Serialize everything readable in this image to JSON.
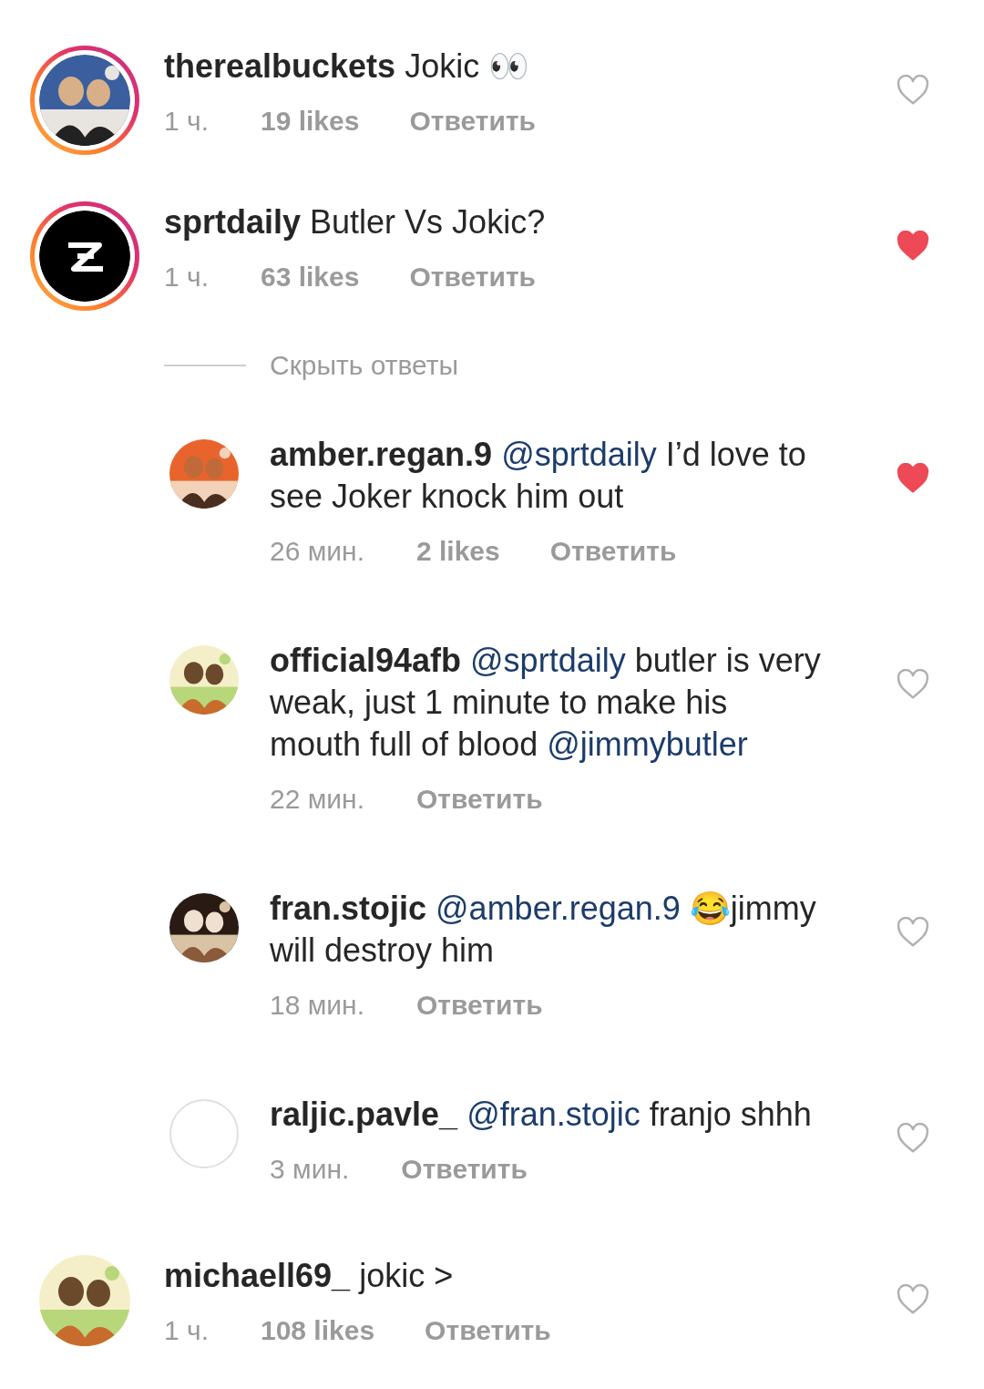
{
  "comments": [
    {
      "user": "therealbuckets",
      "segments": [
        {
          "kind": "plain",
          "text": "Jokic 👀"
        }
      ],
      "time": "1 ч.",
      "likes": "19 likes",
      "reply": "Ответить",
      "liked": false,
      "story_ring": true,
      "avatar": {
        "kind": "picture"
      }
    },
    {
      "user": "sprtdaily",
      "segments": [
        {
          "kind": "plain",
          "text": "Butler Vs Jokic?"
        }
      ],
      "time": "1 ч.",
      "likes": "63 likes",
      "reply": "Ответить",
      "liked": true,
      "story_ring": true,
      "avatar": {
        "kind": "logo"
      },
      "replies_toggle": "Скрыть ответы",
      "children": [
        {
          "user": "amber.regan.9",
          "segments": [
            {
              "kind": "mention",
              "text": "@sprtdaily"
            },
            {
              "kind": "plain",
              "text": " I’d love to see Joker knock him out"
            }
          ],
          "time": "26 мин.",
          "likes": "2 likes",
          "reply": "Ответить",
          "liked": true,
          "story_ring": false,
          "avatar": {
            "kind": "picture"
          }
        },
        {
          "user": "official94afb",
          "segments": [
            {
              "kind": "mention",
              "text": "@sprtdaily"
            },
            {
              "kind": "plain",
              "text": " butler is very weak, just 1 minute to make his mouth full of blood "
            },
            {
              "kind": "mention",
              "text": "@jimmybutler"
            }
          ],
          "time": "22 мин.",
          "reply": "Ответить",
          "liked": false,
          "story_ring": false,
          "avatar": {
            "kind": "picture"
          }
        },
        {
          "user": "fran.stojic",
          "segments": [
            {
              "kind": "mention",
              "text": "@amber.regan.9"
            },
            {
              "kind": "plain",
              "text": " 😂jimmy will destroy him"
            }
          ],
          "time": "18 мин.",
          "reply": "Ответить",
          "liked": false,
          "story_ring": false,
          "avatar": {
            "kind": "picture"
          }
        },
        {
          "user": "raljic.pavle_",
          "segments": [
            {
              "kind": "mention",
              "text": "@fran.stojic"
            },
            {
              "kind": "plain",
              "text": " franjo shhh"
            }
          ],
          "time": "3 мин.",
          "reply": "Ответить",
          "liked": false,
          "story_ring": false,
          "avatar": {
            "kind": "empty"
          }
        }
      ]
    },
    {
      "user": "michaell69_",
      "segments": [
        {
          "kind": "plain",
          "text": "jokic >"
        }
      ],
      "time": "1 ч.",
      "likes": "108 likes",
      "reply": "Ответить",
      "liked": false,
      "story_ring": false,
      "avatar": {
        "kind": "picture"
      }
    }
  ]
}
